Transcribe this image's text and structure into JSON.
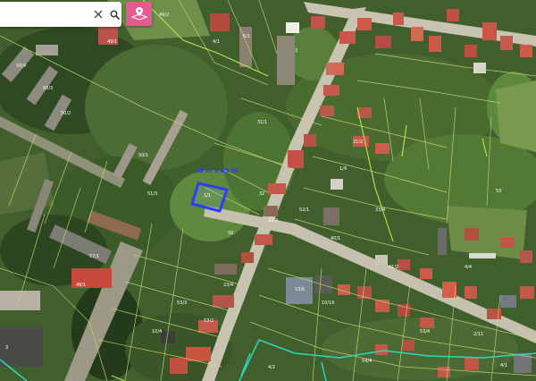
{
  "search": {
    "value": "",
    "placeholder": ""
  },
  "icons": {
    "clear": "close-icon",
    "search": "search-icon",
    "pin": "map-pin-icon"
  },
  "colors": {
    "accent": "#e45b8f",
    "selected_parcel": "#2a3cff",
    "parcel_lines": "#c9d67a",
    "boundary_lines": "#2fd6b8",
    "highlight_lines": "#b8e84a"
  },
  "measurement_label": "28 m x 29 m",
  "parcel_labels": [
    "49/1",
    "49/2",
    "4/1",
    "5/1",
    "3",
    "50/4",
    "50/3",
    "50/2",
    "50/1",
    "31/1",
    "31/2",
    "1/4",
    "51/3",
    "52/1",
    "32",
    "32/2",
    "33/4",
    "40/1",
    "50",
    "57/1",
    "53",
    "4/4",
    "41/2",
    "48/1",
    "53/6",
    "23/4",
    "53/3",
    "53/2",
    "10/4",
    "10/16",
    "53/4",
    "2/11",
    "3",
    "4/1",
    "4/2",
    "54/4"
  ],
  "selected_parcel_label": "1/1"
}
